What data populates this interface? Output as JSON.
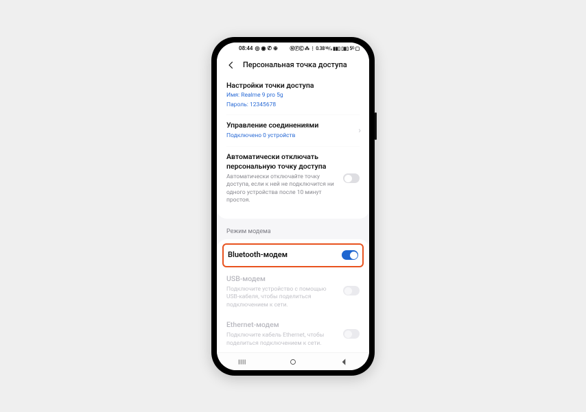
{
  "statusbar": {
    "time": "08:44",
    "left_icons": "◎ ◉ ✆ ⊕",
    "right_icons": "ⓃⒻⒸ ⁂ ⋮ 0.38 ᵏᵇ/ₛ ▮▮▯ ▯▮▯ 5ᴳ ▢"
  },
  "header": {
    "title": "Персональная точка доступа"
  },
  "hotspot": {
    "title": "Настройки точки доступа",
    "name_label": "Имя: Realme 9 pro 5g",
    "pass_label": "Пароль: 12345678"
  },
  "connections": {
    "title": "Управление соединениями",
    "subtitle": "Подключено 0 устройств"
  },
  "auto_off": {
    "title": "Автоматически отключать персональную точку доступа",
    "desc": "Автоматически отключайте точку доступа, если к ней не подключится ни одного устройства после 10 минут простоя."
  },
  "section": "Режим модема",
  "bluetooth": {
    "title": "Bluetooth-модем"
  },
  "usb": {
    "title": "USB-модем",
    "desc": "Подключите устройство с помощью USB-кабеля, чтобы поделиться подключением к сети."
  },
  "ethernet": {
    "title": "Ethernet-модем",
    "desc": "Подключите кабель Ethernet, чтобы поделиться подключением к сети."
  }
}
